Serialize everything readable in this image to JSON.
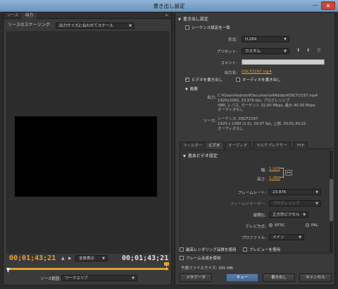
{
  "window": {
    "title": "書き出し設定",
    "min_label": "—",
    "close_label": "✕"
  },
  "left": {
    "tabs": [
      "ソース",
      "出力"
    ],
    "panel_menu": "≡",
    "scaling_label": "ソースのスケーリング:",
    "scaling_value": "出力サイズに合わせてスケール",
    "timecode_left": "00;01;43;21",
    "timecode_right": "00;01;43;21",
    "zoom_value": "全体表示",
    "source_range_label": "ソース範囲:",
    "source_range_value": "ワークエリア"
  },
  "right": {
    "export_section": "書き出し設定",
    "match_sequence": "シーケンス設定を一致",
    "format_label": "形式:",
    "format_value": "H.264",
    "preset_label": "プリセット:",
    "preset_value": "カスタム",
    "comment_label": "コメント:",
    "output_name_label": "出力名:",
    "output_name_value": "DSCF2197.mp4",
    "export_video": "ビデオを書き出し",
    "export_audio": "オーディオを書き出し",
    "summary_title": "概要",
    "summary_output_label": "出力:",
    "summary_output_lines": [
      "C:¥Users¥admin¥Documents¥Adobe¥DSCF2197.mp4",
      "1920x1080, 23.976 fps, プログレッシブ",
      "VBR, 1 パス, ターゲット 32.00 Mbps, 最大 40.00 Mbps",
      "オーディオなし"
    ],
    "summary_source_label": "ソース:",
    "summary_source_lines": [
      "シーケンス, DSCF2197",
      "1920 x 1080 (1.0), 29.97 fps, 上部, 00;01;43;21",
      "オーディオなし"
    ],
    "subtabs": [
      "フィルター",
      "ビデオ",
      "オーディオ",
      "マルチプレクサー",
      "FTP"
    ],
    "basic_video": "基本ビデオ設定",
    "width_label": "幅:",
    "width_value": "1,920",
    "height_label": "高さ:",
    "height_value": "1,080",
    "chain_label": "⊕⊕",
    "framerate_label": "フレームレート:",
    "framerate_value": "23.976",
    "fieldorder_label": "フィールドオーダー:",
    "fieldorder_value": "プログレッシブ",
    "aspect_label": "縦横比:",
    "aspect_value": "正方形ピクセル",
    "tvstandard_label": "テレビ方式:",
    "ntsc": "NTSC",
    "pal": "PAL",
    "profile_label": "プロファイル:",
    "profile_value": "メイン",
    "max_render": "最高レンダリング品質を使用",
    "use_preview": "プレビューを使用",
    "use_frame_blend": "フレーム合成を使用",
    "est_filesize_label": "予測ファイルサイズ:",
    "est_filesize_value": "395 MB",
    "buttons": {
      "metadata": "メタデータ",
      "queue": "キュー",
      "export": "書き出し",
      "cancel": "キャンセル"
    }
  }
}
